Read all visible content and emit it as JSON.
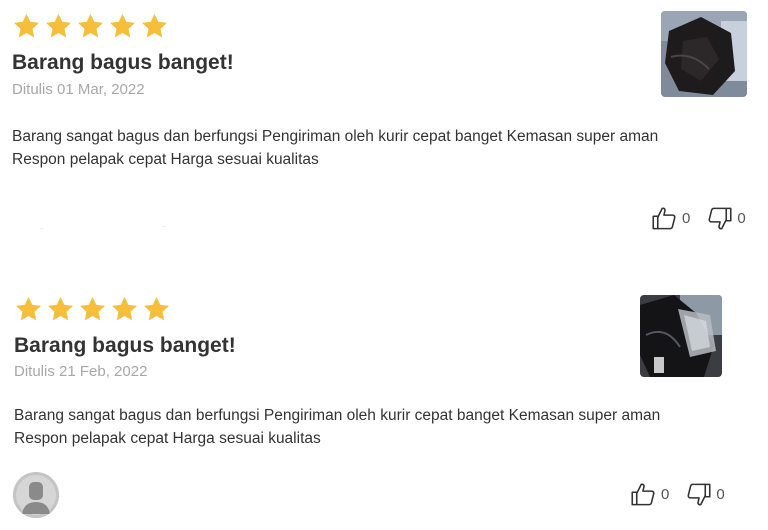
{
  "reviews": [
    {
      "rating": 5,
      "title": "Barang bagus banget!",
      "date": "Ditulis 01 Mar, 2022",
      "body_lines": [
        "Barang sangat bagus dan berfungsi Pengiriman oleh kurir cepat banget Kemasan super aman",
        "Respon pelapak cepat Harga sesuai kualitas"
      ],
      "likes": "0",
      "dislikes": "0",
      "photo_icon": "product-photo"
    },
    {
      "rating": 5,
      "title": "Barang bagus banget!",
      "date": "Ditulis 21 Feb, 2022",
      "body_lines": [
        "Barang sangat bagus dan berfungsi Pengiriman oleh kurir cepat banget Kemasan super aman",
        "Respon pelapak cepat Harga sesuai kualitas"
      ],
      "likes": "0",
      "dislikes": "0",
      "photo_icon": "product-photo",
      "avatar_icon": "user-avatar-icon"
    }
  ],
  "colors": {
    "star": "#F6BF3B",
    "text": "#333333",
    "muted": "#A7A7A7"
  }
}
